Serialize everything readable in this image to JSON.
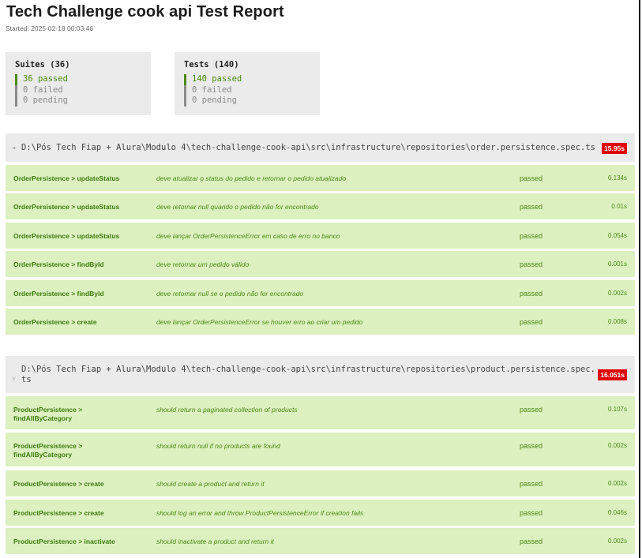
{
  "report": {
    "title": "Tech Challenge cook api Test Report",
    "started": "Started: 2025-02-18 00:03:46"
  },
  "summary": {
    "suites": {
      "header": "Suites (36)",
      "passed": "36 passed",
      "failed": "0 failed",
      "pending": "0 pending"
    },
    "tests": {
      "header": "Tests (140)",
      "passed": "140 passed",
      "failed": "0 failed",
      "pending": "0 pending"
    }
  },
  "suites": [
    {
      "chevron": "„",
      "path": "D:\\Pós Tech Fiap + Alura\\Modulo 4\\tech-challenge-cook-api\\src\\infrastructure\\repositories\\order.persistence.spec.ts",
      "duration": "15.95s",
      "tests": [
        {
          "name": "OrderPersistence > updateStatus",
          "desc": "deve atualizar o status do pedido e retornar o pedido atualizado",
          "status": "passed",
          "time": "0.134s"
        },
        {
          "name": "OrderPersistence > updateStatus",
          "desc": "deve retornar null quando o pedido não for encontrado",
          "status": "passed",
          "time": "0.01s"
        },
        {
          "name": "OrderPersistence > updateStatus",
          "desc": "deve lançar OrderPersistenceError em caso de erro no banco",
          "status": "passed",
          "time": "0.054s"
        },
        {
          "name": "OrderPersistence > findById",
          "desc": "deve retornar um pedido válido",
          "status": "passed",
          "time": "0.001s"
        },
        {
          "name": "OrderPersistence > findById",
          "desc": "deve retornar null se o pedido não for encontrado",
          "status": "passed",
          "time": "0.002s"
        },
        {
          "name": "OrderPersistence > create",
          "desc": "deve lançar OrderPersistenceError se houver erro ao criar um pedido",
          "status": "passed",
          "time": "0.008s"
        }
      ]
    },
    {
      "chevron": "˅",
      "path_line1": "D:\\Pós Tech Fiap + Alura\\Modulo 4\\tech-challenge-cook-api\\src\\infrastructure\\repositories\\product.persistence.spec.",
      "path_line2": "ts",
      "duration": "16.051s",
      "tests": [
        {
          "name_line1": "ProductPersistence >",
          "name_line2": "findAllByCategory",
          "desc": "should return a paginated collection of products",
          "status": "passed",
          "time": "0.107s"
        },
        {
          "name_line1": "ProductPersistence >",
          "name_line2": "findAllByCategory",
          "desc": "should return null if no products are found",
          "status": "passed",
          "time": "0.002s"
        },
        {
          "name": "ProductPersistence > create",
          "desc": "should create a product and return it",
          "status": "passed",
          "time": "0.002s"
        },
        {
          "name": "ProductPersistence > create",
          "desc": "should log an error and throw ProductPersistenceError if creation fails",
          "status": "passed",
          "time": "0.046s"
        },
        {
          "name": "ProductPersistence > inactivate",
          "desc": "should inactivate a product and return it",
          "status": "passed",
          "time": "0.002s"
        }
      ]
    }
  ]
}
